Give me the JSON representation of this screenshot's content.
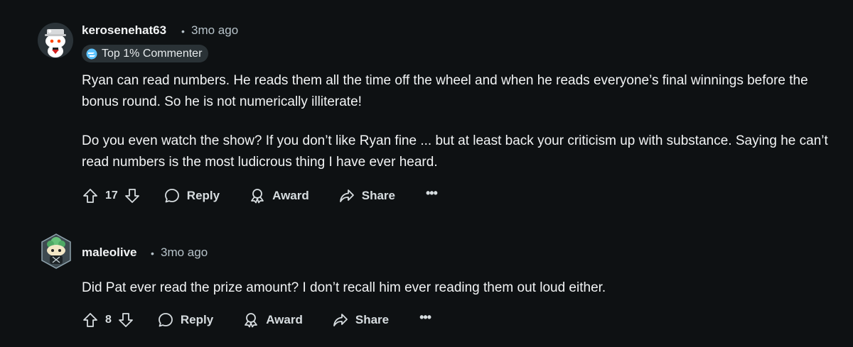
{
  "comments": [
    {
      "username": "kerosenehat63",
      "separator": "•",
      "time": "3mo ago",
      "flair": "Top 1% Commenter",
      "paragraphs": [
        "Ryan can read numbers. He reads them all the time off the wheel and when he reads everyone’s final winnings before the bonus round. So he is not numerically illiterate!",
        "Do you even watch the show? If you don’t like Ryan fine ... but at least back your criticism up with substance. Saying he can’t read numbers is the most ludicrous thing I have ever heard."
      ],
      "score": "17",
      "reply_label": "Reply",
      "award_label": "Award",
      "share_label": "Share",
      "more_label": "•••"
    },
    {
      "username": "maleolive",
      "separator": "•",
      "time": "3mo ago",
      "paragraphs": [
        "Did Pat ever read the prize amount? I don’t recall him ever reading them out loud either."
      ],
      "score": "8",
      "reply_label": "Reply",
      "award_label": "Award",
      "share_label": "Share",
      "more_label": "•••"
    }
  ],
  "colors": {
    "background": "#0e1113",
    "text": "#f2f4f5",
    "muted": "#b7c3ca",
    "flair_bg": "#2a3236"
  }
}
